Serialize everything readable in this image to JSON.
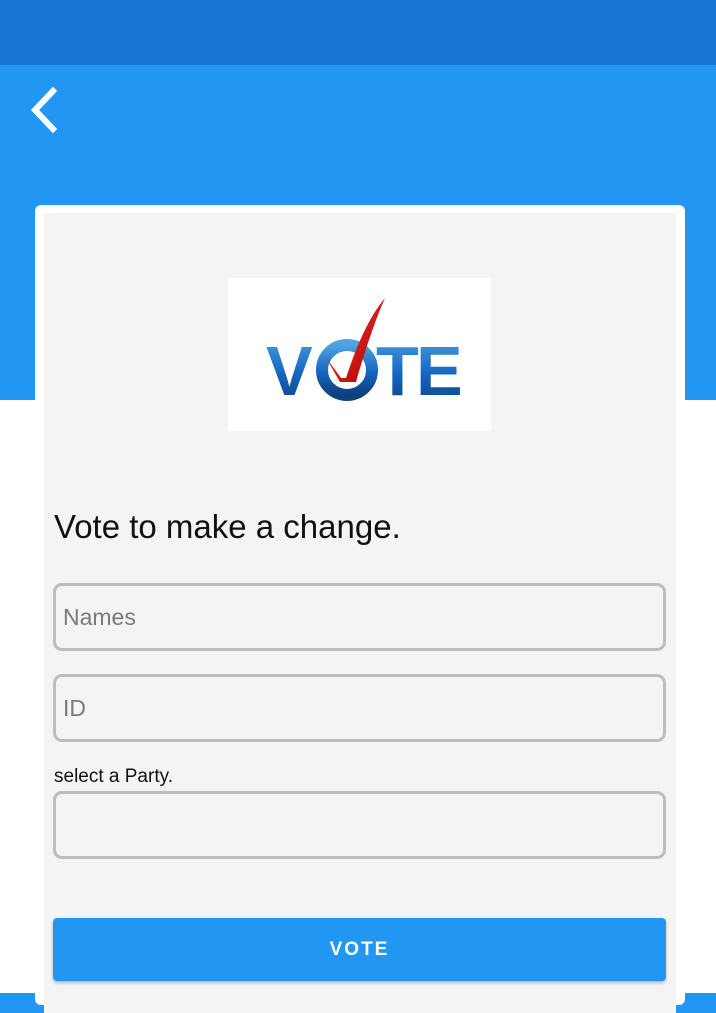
{
  "colors": {
    "status_bar": "#1976D2",
    "header": "#2196F3",
    "card": "#F4F4F4",
    "field_border": "#BDBDBD",
    "button": "#2196F3",
    "logo_blue": "#1565C0",
    "logo_check": "#D50000"
  },
  "header": {
    "back_icon": "chevron-left-icon"
  },
  "logo": {
    "letter_v": "V",
    "letter_t": "T",
    "letter_e": "E"
  },
  "form": {
    "headline": "Vote to make a change.",
    "names_placeholder": "Names",
    "id_placeholder": "ID",
    "party_label": "select a Party.",
    "party_value": "",
    "submit_label": "VOTE"
  }
}
